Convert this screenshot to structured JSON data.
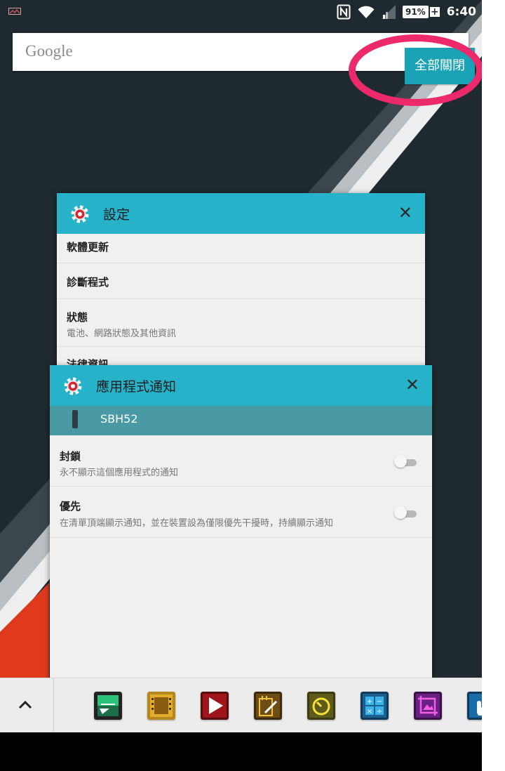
{
  "status_bar": {
    "battery_percent": "91%",
    "time": "6:40"
  },
  "search_bar": {
    "logo_text": "Google"
  },
  "close_all_button": {
    "label": "全部關閉"
  },
  "settings_card": {
    "title": "設定",
    "close_glyph": "✕",
    "items": [
      {
        "title": "軟體更新"
      },
      {
        "title": "診斷程式"
      },
      {
        "title": "狀態",
        "subtitle": "電池、網路狀態及其他資訊"
      },
      {
        "title": "法律資訊"
      }
    ]
  },
  "notification_card": {
    "title": "應用程式通知",
    "close_glyph": "✕",
    "device_name": "SBH52",
    "options": [
      {
        "title": "封鎖",
        "subtitle": "永不顯示這個應用程式的通知",
        "enabled": false
      },
      {
        "title": "優先",
        "subtitle": "在清單頂端顯示通知，並在裝置設為僅限優先干擾時，持續顯示通知",
        "enabled": false
      }
    ]
  },
  "dock": {
    "apps": [
      "sketch-app-icon",
      "movie-creator-icon",
      "video-player-icon",
      "notepad-icon",
      "timer-icon",
      "calculator-icon",
      "screen-crop-icon",
      "touch-block-icon"
    ]
  },
  "colors": {
    "accent": "#26b3c9",
    "close_all": "#1aa3b4",
    "highlight": "#ec2a6b",
    "wallpaper_dark": "#1f2a30",
    "wallpaper_red": "#e03a1d"
  }
}
